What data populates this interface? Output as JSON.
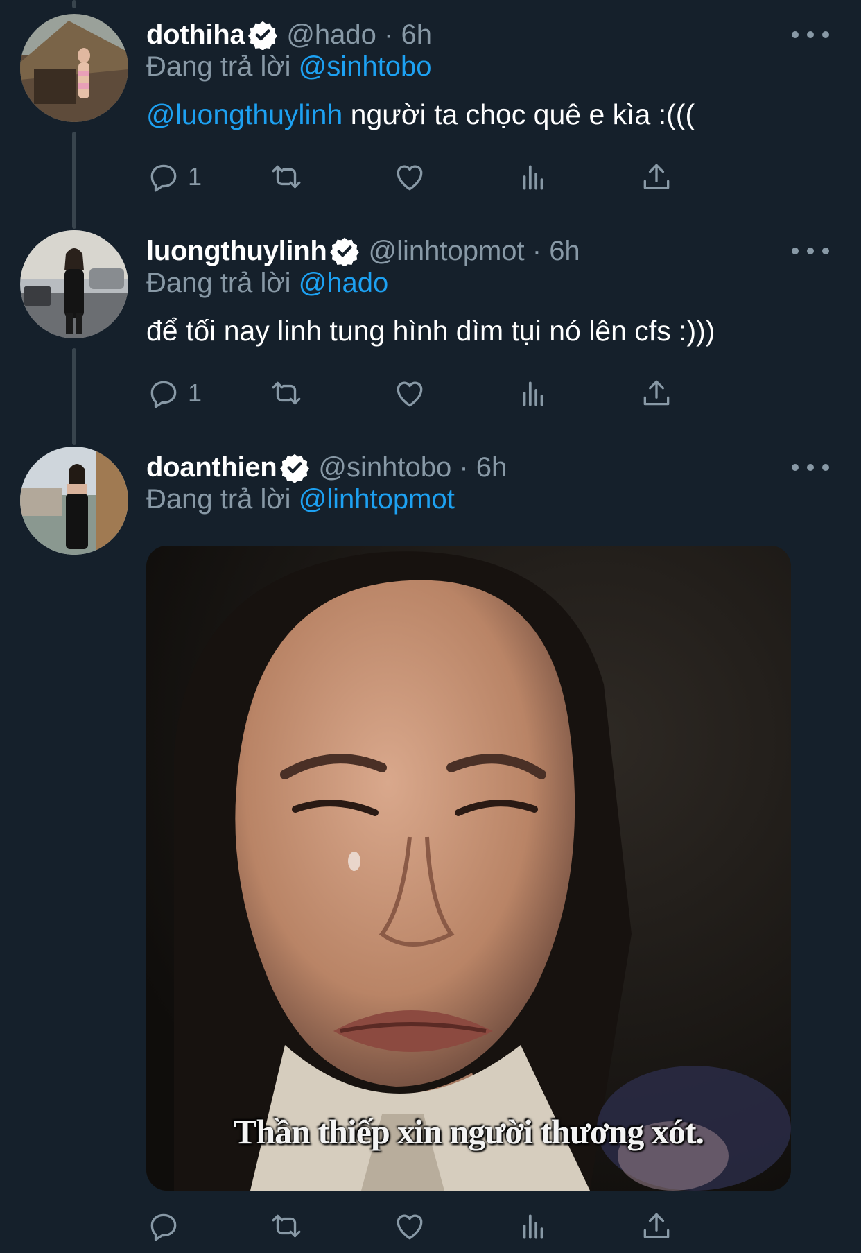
{
  "theme": {
    "background": "#15202b",
    "secondary_text": "#8899a6",
    "link": "#1da1f2",
    "verified": "#ffffff"
  },
  "tweets": [
    {
      "name": "dothiha",
      "handle": "@hado · 6h",
      "reply_prefix": "Đang trả lời ",
      "reply_to": "@sinhtobo",
      "text_mention": "@luongthuylinh",
      "text": " người ta chọc quê e kìa :(((",
      "reply_count": "1"
    },
    {
      "name": "luongthuylinh",
      "handle": "@linhtopmot · 6h",
      "reply_prefix": "Đang trả lời ",
      "reply_to": "@hado",
      "text": "để tối nay linh tung hình dìm tụi nó lên cfs :)))",
      "reply_count": "1"
    },
    {
      "name": "doanthien",
      "handle": "@sinhtobo · 6h",
      "reply_prefix": "Đang trả lời ",
      "reply_to": "@linhtopmot",
      "media_caption": "Thần thiếp xin người thương xót."
    }
  ],
  "icons": [
    "verified-badge-icon",
    "more-icon",
    "reply-icon",
    "retweet-icon",
    "like-icon",
    "analytics-icon",
    "share-icon"
  ]
}
